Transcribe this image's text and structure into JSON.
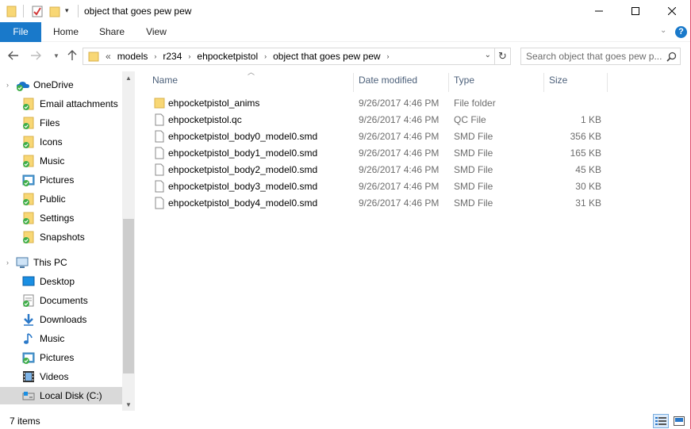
{
  "window": {
    "title": "object that goes pew pew"
  },
  "ribbon": {
    "tabs": [
      {
        "label": "File"
      },
      {
        "label": "Home"
      },
      {
        "label": "Share"
      },
      {
        "label": "View"
      }
    ]
  },
  "address": {
    "overflow": "«",
    "crumbs": [
      "models",
      "r234",
      "ehpocketpistol",
      "object that goes pew pew"
    ]
  },
  "search": {
    "placeholder": "Search object that goes pew p..."
  },
  "navpane": {
    "onedrive": "OneDrive",
    "onedrive_items": [
      "Email attachments",
      "Files",
      "Icons",
      "Music",
      "Pictures",
      "Public",
      "Settings",
      "Snapshots"
    ],
    "thispc": "This PC",
    "thispc_items": [
      {
        "label": "Desktop",
        "icon": "desktop-icon"
      },
      {
        "label": "Documents",
        "icon": "documents-icon"
      },
      {
        "label": "Downloads",
        "icon": "downloads-icon"
      },
      {
        "label": "Music",
        "icon": "music-icon"
      },
      {
        "label": "Pictures",
        "icon": "pictures-icon"
      },
      {
        "label": "Videos",
        "icon": "videos-icon"
      },
      {
        "label": "Local Disk (C:)",
        "icon": "drive-icon"
      }
    ]
  },
  "columns": {
    "name": "Name",
    "date": "Date modified",
    "type": "Type",
    "size": "Size"
  },
  "files": [
    {
      "name": "ehpocketpistol_anims",
      "date": "9/26/2017 4:46 PM",
      "type": "File folder",
      "size": "",
      "icon": "folder-icon"
    },
    {
      "name": "ehpocketpistol.qc",
      "date": "9/26/2017 4:46 PM",
      "type": "QC File",
      "size": "1 KB",
      "icon": "file-icon"
    },
    {
      "name": "ehpocketpistol_body0_model0.smd",
      "date": "9/26/2017 4:46 PM",
      "type": "SMD File",
      "size": "356 KB",
      "icon": "file-icon"
    },
    {
      "name": "ehpocketpistol_body1_model0.smd",
      "date": "9/26/2017 4:46 PM",
      "type": "SMD File",
      "size": "165 KB",
      "icon": "file-icon"
    },
    {
      "name": "ehpocketpistol_body2_model0.smd",
      "date": "9/26/2017 4:46 PM",
      "type": "SMD File",
      "size": "45 KB",
      "icon": "file-icon"
    },
    {
      "name": "ehpocketpistol_body3_model0.smd",
      "date": "9/26/2017 4:46 PM",
      "type": "SMD File",
      "size": "30 KB",
      "icon": "file-icon"
    },
    {
      "name": "ehpocketpistol_body4_model0.smd",
      "date": "9/26/2017 4:46 PM",
      "type": "SMD File",
      "size": "31 KB",
      "icon": "file-icon"
    }
  ],
  "status": {
    "count": "7 items"
  },
  "colors": {
    "accent": "#1979ca",
    "folder": "#f8d775",
    "sync": "#3fae49",
    "header_text": "#4c607a"
  }
}
